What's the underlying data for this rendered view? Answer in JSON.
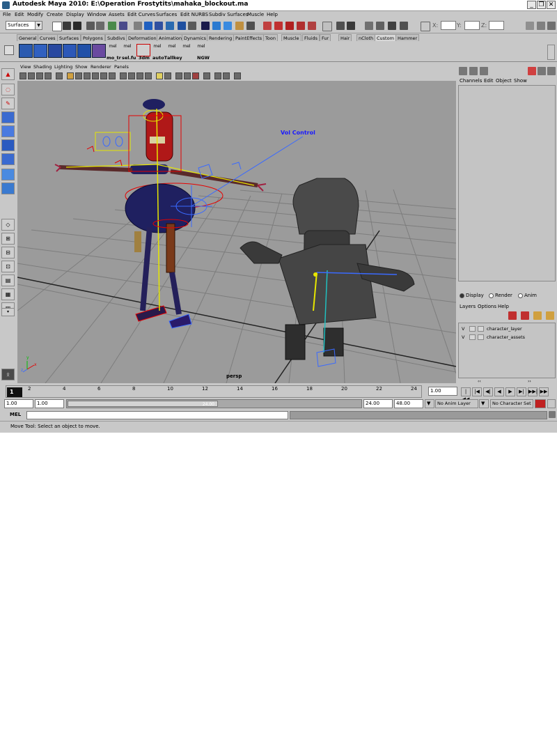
{
  "window": {
    "title": "Autodesk Maya 2010: E:\\Operation Frostytits\\mahaka_blockout.ma",
    "minimize": "_",
    "maximize": "❐",
    "close": "✕"
  },
  "menubar": [
    "File",
    "Edit",
    "Modify",
    "Create",
    "Display",
    "Window",
    "Assets",
    "Edit Curves",
    "Surfaces",
    "Edit NURBS",
    "Subdiv Surfaces",
    "Muscle",
    "Help"
  ],
  "status_line": {
    "menu_set": "Surfaces",
    "x_label": "X:",
    "y_label": "Y:",
    "z_label": "Z:",
    "x_value": "",
    "y_value": "",
    "z_value": ""
  },
  "shelf_tabs": [
    "General",
    "Curves",
    "Surfaces",
    "Polygons",
    "Subdivs",
    "Deformation",
    "Animation",
    "Dynamics",
    "Rendering",
    "PaintEffects",
    "Toon",
    "Muscle",
    "Fluids",
    "Fur",
    "Hair",
    "nCloth",
    "Custom",
    "Hammer"
  ],
  "shelf_tab_active": "Custom",
  "shelf_labels": [
    "mo_tr",
    "sel.fu",
    "3dm",
    "autoT",
    "allkey",
    "NGW"
  ],
  "shelf_mel": [
    "mel",
    "mel",
    "mel",
    "mel",
    "mel",
    "mel"
  ],
  "viewport_menu": [
    "View",
    "Shading",
    "Lighting",
    "Show",
    "Renderer",
    "Panels"
  ],
  "viewport": {
    "camera_label": "persp",
    "annotation": "Vol Control",
    "axis_x": "x",
    "axis_y": "y",
    "axis_z": "z",
    "background": "#9b9b9b"
  },
  "right_panel": {
    "menu": [
      "Channels",
      "Edit",
      "Object",
      "Show"
    ],
    "tabs": [
      "Display",
      "Render",
      "Anim"
    ],
    "tab_selected": "Display",
    "layer_menu": [
      "Layers",
      "Options",
      "Help"
    ],
    "layers": [
      {
        "visible": "V",
        "name": "character_layer"
      },
      {
        "visible": "V",
        "name": "character_assets"
      }
    ],
    "scroll_left": "‹‹",
    "scroll_right": "››"
  },
  "time_slider": {
    "current_frame": "1",
    "ticks": [
      "2",
      "4",
      "6",
      "8",
      "10",
      "12",
      "14",
      "16",
      "18",
      "20",
      "22",
      "24"
    ],
    "current_time": "1.00",
    "playback_buttons": [
      "|◀◀",
      "|◀",
      "◀|",
      "◀",
      "▶",
      "▶|",
      "▶▶|",
      "▶▶"
    ]
  },
  "range_slider": {
    "start_time": "1.00",
    "playback_start": "1.00",
    "handle_label": "24.00",
    "playback_end": "24.00",
    "end_time": "48.00",
    "anim_layer": "No Anim Layer",
    "character_set": "No Character Set"
  },
  "command_line": {
    "label": "MEL",
    "input": ""
  },
  "help_line": "Move Tool: Select an object to move.",
  "colors": {
    "ui_bg": "#c8c8c8",
    "viewport_bg": "#9b9b9b",
    "annotation": "#1a1aff",
    "joint_yellow": "#e6e600",
    "control_red": "#e60000"
  }
}
